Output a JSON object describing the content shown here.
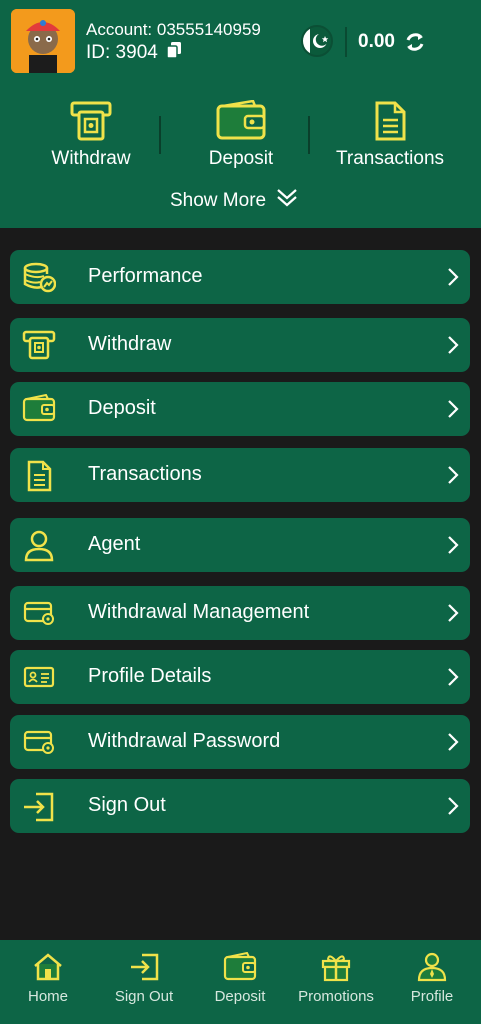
{
  "account": {
    "account_text": "Account: 03555140959",
    "id_text": "ID: 3904",
    "balance": "0.00"
  },
  "quick_actions": [
    {
      "label": "Withdraw",
      "icon": "atm-icon"
    },
    {
      "label": "Deposit",
      "icon": "wallet-icon"
    },
    {
      "label": "Transactions",
      "icon": "document-icon"
    }
  ],
  "show_more_label": "Show More",
  "menu": [
    {
      "label": "Performance",
      "icon": "coins-chart-icon"
    },
    {
      "label": "Withdraw",
      "icon": "atm-icon"
    },
    {
      "label": "Deposit",
      "icon": "wallet-icon"
    },
    {
      "label": "Transactions",
      "icon": "document-icon"
    },
    {
      "label": "Agent",
      "icon": "person-icon"
    },
    {
      "label": "Withdrawal Management",
      "icon": "card-gear-icon"
    },
    {
      "label": "Profile Details",
      "icon": "id-card-icon"
    },
    {
      "label": "Withdrawal Password",
      "icon": "card-lock-icon"
    },
    {
      "label": "Sign Out",
      "icon": "sign-out-icon"
    }
  ],
  "bottom_nav": [
    {
      "label": "Home",
      "icon": "home-icon"
    },
    {
      "label": "Sign Out",
      "icon": "sign-out-icon"
    },
    {
      "label": "Deposit",
      "icon": "wallet-icon"
    },
    {
      "label": "Promotions",
      "icon": "gift-icon"
    },
    {
      "label": "Profile",
      "icon": "profile-icon"
    }
  ],
  "colors": {
    "header_green": "#0d6546",
    "background": "#1a1a1a",
    "icon_yellow": "#f0e24a",
    "text": "#ffffff"
  }
}
